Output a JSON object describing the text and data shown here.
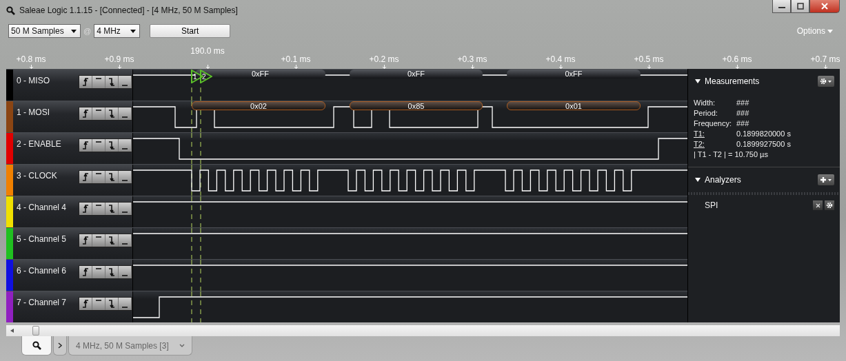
{
  "window": {
    "title": "Saleae Logic 1.1.15 - [Connected] - [4 MHz, 50 M Samples]"
  },
  "toolbar": {
    "sample_count": "50 M Samples",
    "at": "@",
    "sample_rate": "4 MHz",
    "start": "Start",
    "options": "Options"
  },
  "timeline": {
    "ticks": [
      {
        "label": "+0.8 ms",
        "kind": "tick"
      },
      {
        "label": "+0.9 ms",
        "kind": "tick"
      },
      {
        "label": "190.0 ms",
        "kind": "cursor"
      },
      {
        "label": "+0.1 ms",
        "kind": "tick"
      },
      {
        "label": "+0.2 ms",
        "kind": "tick"
      },
      {
        "label": "+0.3 ms",
        "kind": "tick"
      },
      {
        "label": "+0.4 ms",
        "kind": "tick"
      },
      {
        "label": "+0.5 ms",
        "kind": "tick"
      },
      {
        "label": "+0.6 ms",
        "kind": "tick"
      },
      {
        "label": "+0.7 ms",
        "kind": "tick"
      }
    ]
  },
  "cursors": [
    "1",
    "2"
  ],
  "channels": [
    {
      "label": "0 - MISO",
      "color": "#000000",
      "decoded": [
        "0xFF",
        "0xFF",
        "0xFF"
      ]
    },
    {
      "label": "1 - MOSI",
      "color": "#8b4513",
      "decoded": [
        "0x02",
        "0x85",
        "0x01"
      ]
    },
    {
      "label": "2 - ENABLE",
      "color": "#e00000"
    },
    {
      "label": "3 - CLOCK",
      "color": "#f08000"
    },
    {
      "label": "4 - Channel 4",
      "color": "#f0e000"
    },
    {
      "label": "5 - Channel 5",
      "color": "#20c020"
    },
    {
      "label": "6 - Channel 6",
      "color": "#1010e0"
    },
    {
      "label": "7 - Channel 7",
      "color": "#9020c0"
    }
  ],
  "measurements": {
    "title": "Measurements",
    "rows": [
      {
        "label": "Width:",
        "value": "###",
        "link": false
      },
      {
        "label": "Period:",
        "value": "###",
        "link": false
      },
      {
        "label": "Frequency:",
        "value": "###",
        "link": false
      },
      {
        "label": "T1:",
        "value": "0.1899820000 s",
        "link": true
      },
      {
        "label": "T2:",
        "value": "0.1899927500 s",
        "link": true
      }
    ],
    "difference": "| T1 - T2 | = 10.750 µs"
  },
  "analyzers": {
    "title": "Analyzers",
    "items": [
      {
        "name": "SPI"
      }
    ]
  },
  "tabs": [
    {
      "kind": "search",
      "selected": true
    },
    {
      "kind": "expand",
      "selected": false
    },
    {
      "kind": "capture",
      "label": "4 MHz, 50 M Samples [3]",
      "selected": false
    }
  ]
}
